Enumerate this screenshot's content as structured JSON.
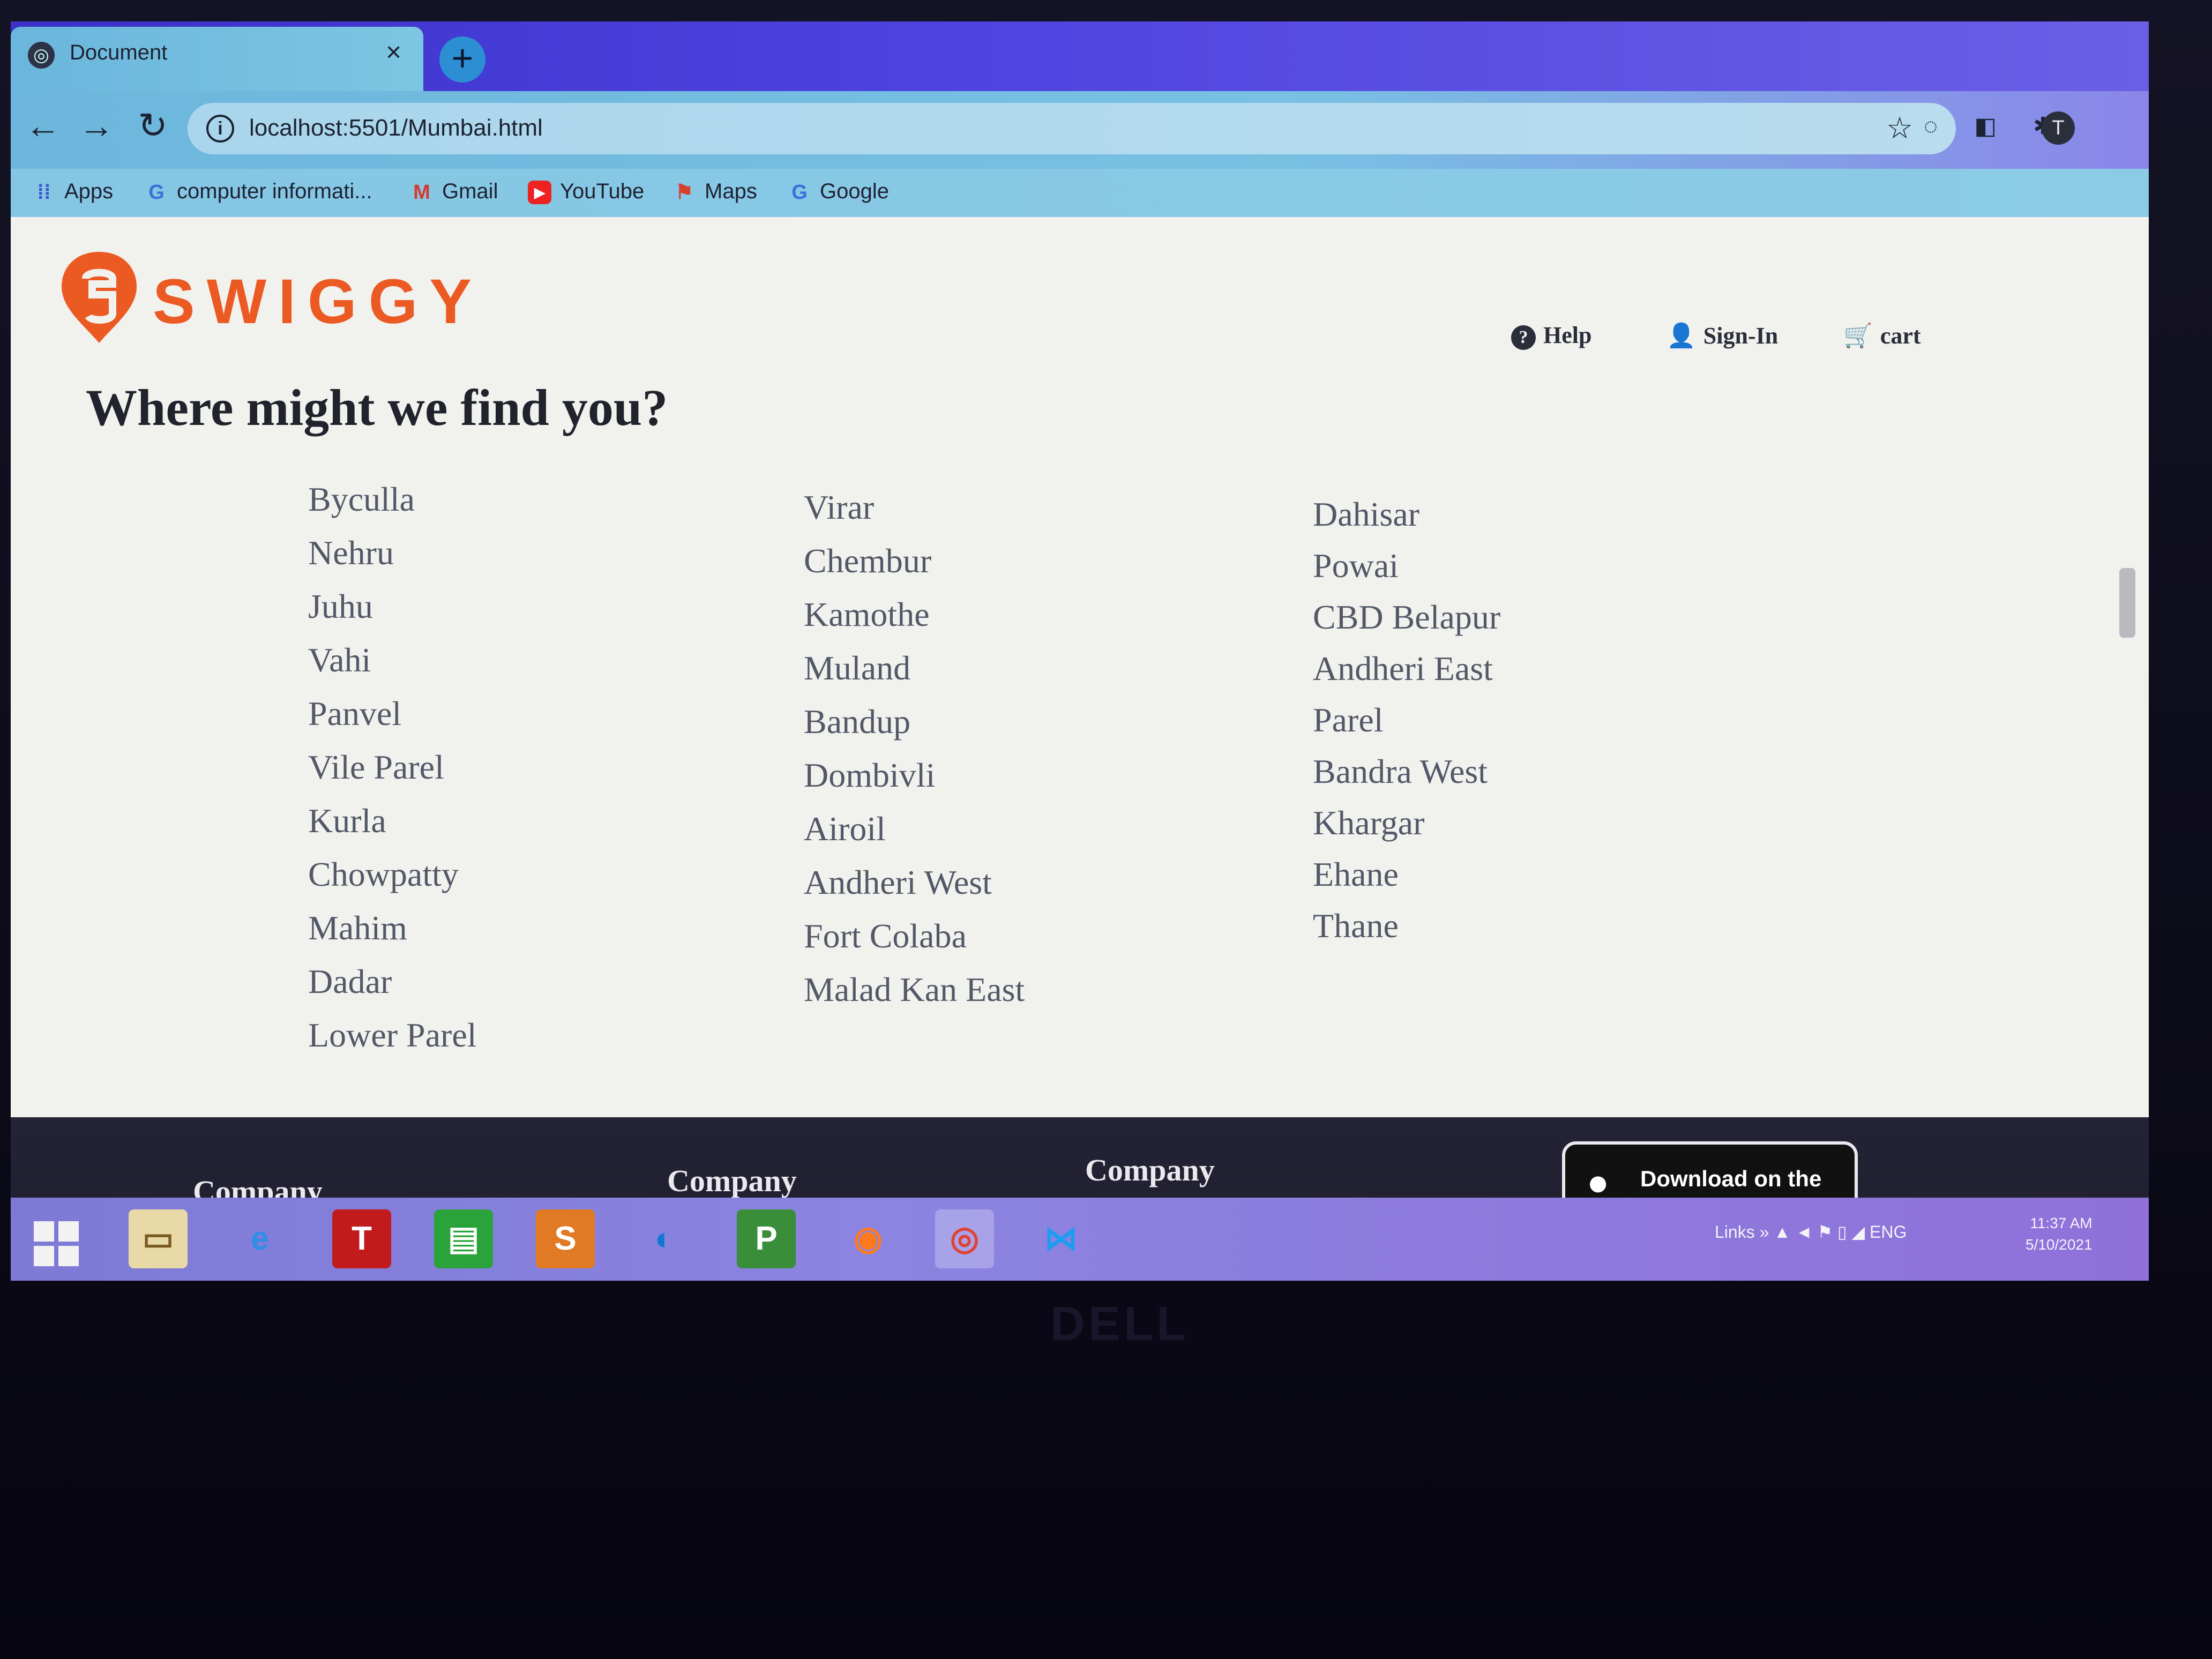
{
  "browser": {
    "tab_title": "Document",
    "tab_close": "×",
    "new_tab": "+",
    "window_close": "×",
    "url": "localhost:5501/Mumbai.html",
    "info_icon": "i",
    "bookmarks": [
      {
        "label": "Apps",
        "icon": "apps-grid-icon"
      },
      {
        "label": "computer informati...",
        "icon": "google-icon"
      },
      {
        "label": "Gmail",
        "icon": "gmail-icon"
      },
      {
        "label": "YouTube",
        "icon": "youtube-icon"
      },
      {
        "label": "Maps",
        "icon": "maps-icon"
      },
      {
        "label": "Google",
        "icon": "google-icon"
      }
    ],
    "profile_initial": "T"
  },
  "page": {
    "brand": "SWIGGY",
    "brand_color": "#ec5a24",
    "nav": {
      "help": "Help",
      "sign_in": "Sign-In",
      "cart": "cart"
    },
    "title": "Where might we find you?",
    "locations": {
      "col1": [
        "Byculla",
        "Nehru",
        "Juhu",
        "Vahi",
        "Panvel",
        "Vile Parel",
        "Kurla",
        "Chowpatty",
        "Mahim",
        "Dadar",
        "Lower Parel"
      ],
      "col2": [
        "Virar",
        "Chembur",
        "Kamothe",
        "Muland",
        "Bandup",
        "Dombivli",
        "Airoil",
        "Andheri West",
        "Fort Colaba",
        "Malad Kan East"
      ],
      "col3": [
        "Dahisar",
        "Powai",
        "CBD Belapur",
        "Andheri East",
        "Parel",
        "Bandra West",
        "Khargar",
        "Ehane",
        "Thane"
      ]
    },
    "footer": {
      "headings": [
        "Company",
        "Company",
        "Company"
      ],
      "app_store": "Download on the"
    }
  },
  "taskbar": {
    "tray_links": "Links",
    "tray_lang": "ENG",
    "time": "11:37 AM",
    "date": "5/10/2021"
  },
  "hardware": {
    "logo": "DELL"
  }
}
